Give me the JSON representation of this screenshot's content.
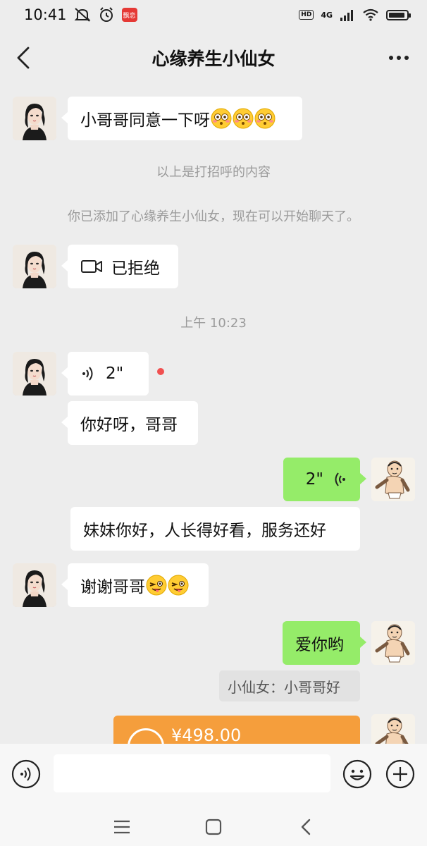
{
  "status_bar": {
    "time": "10:41",
    "app_badge": "飘恋",
    "hd": "HD",
    "network": "4G"
  },
  "nav": {
    "title": "心缘养生小仙女"
  },
  "messages": {
    "m1_text": "小哥哥同意一下呀",
    "greeting_note": "以上是打招呼的内容",
    "added_note": "你已添加了心缘养生小仙女，现在可以开始聊天了。",
    "video_call_status": "已拒绝",
    "time_divider": "上午 10:23",
    "voice_left_duration": "2\"",
    "m2_text": "你好呀，哥哥",
    "voice_right_duration": "2\"",
    "m3_text": "妹妹你好，人长得好看，服务还好",
    "m4_text": "谢谢哥哥",
    "m5_text": "爱你哟",
    "quote_text": "小仙女：小哥哥好",
    "transfer_amount": "¥498.00"
  },
  "input_bar": {
    "placeholder": ""
  },
  "colors": {
    "background": "#ededed",
    "bubble_self": "#95ec69",
    "bubble_other": "#ffffff",
    "transfer": "#f59e3c",
    "unread_dot": "#f15050"
  },
  "icons": {
    "back": "chevron-left-icon",
    "more": "more-dots-icon",
    "video": "video-camera-icon",
    "voice": "voice-wave-icon",
    "emoji": "smiley-icon",
    "plus": "plus-circle-icon"
  }
}
